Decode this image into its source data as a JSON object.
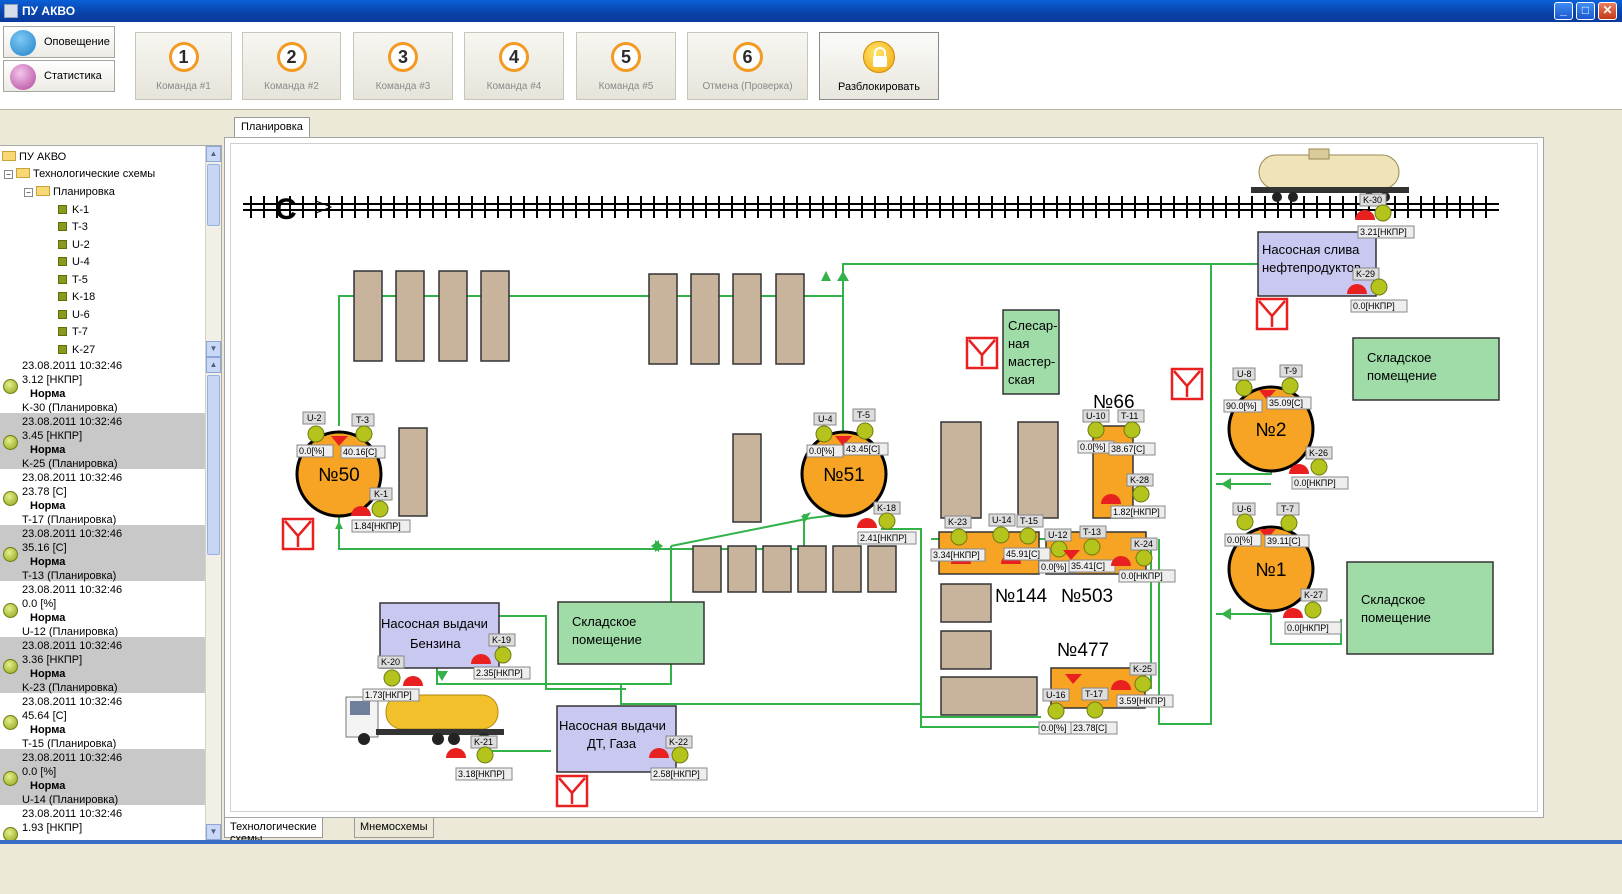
{
  "window": {
    "title": "ПУ АКВО",
    "minimize": "_",
    "maximize": "□",
    "close": "✕"
  },
  "left_tabs": [
    {
      "label": "Оповещение",
      "icon": "megaphone-icon"
    },
    {
      "label": "Статистика",
      "icon": "notepad-icon"
    }
  ],
  "commands": [
    {
      "num": "1",
      "label": "Команда #1"
    },
    {
      "num": "2",
      "label": "Команда #2"
    },
    {
      "num": "3",
      "label": "Команда #3"
    },
    {
      "num": "4",
      "label": "Команда #4"
    },
    {
      "num": "5",
      "label": "Команда #5"
    },
    {
      "num": "6",
      "label": "Отмена (Проверка)"
    }
  ],
  "unlock": {
    "label": "Разблокировать",
    "icon": "lock-icon"
  },
  "tree": {
    "root": "ПУ АКВО",
    "folder": "Технологические схемы",
    "subfolder": "Планировка",
    "items": [
      "K-1",
      "T-3",
      "U-2",
      "U-4",
      "T-5",
      "K-18",
      "U-6",
      "T-7",
      "K-27"
    ]
  },
  "events": [
    {
      "time": "23.08.2011 10:32:46",
      "value": "3.12 [НКПР]",
      "status": "Норма",
      "source": "K-30 (Планировка)"
    },
    {
      "time": "23.08.2011 10:32:46",
      "value": "3.45 [НКПР]",
      "status": "Норма",
      "source": "K-25 (Планировка)"
    },
    {
      "time": "23.08.2011 10:32:46",
      "value": "23.78 [C]",
      "status": "Норма",
      "source": "T-17 (Планировка)"
    },
    {
      "time": "23.08.2011 10:32:46",
      "value": "35.16 [C]",
      "status": "Норма",
      "source": "T-13 (Планировка)"
    },
    {
      "time": "23.08.2011 10:32:46",
      "value": "0.0 [%]",
      "status": "Норма",
      "source": "U-12 (Планировка)"
    },
    {
      "time": "23.08.2011 10:32:46",
      "value": "3.36 [НКПР]",
      "status": "Норма",
      "source": "K-23 (Планировка)"
    },
    {
      "time": "23.08.2011 10:32:46",
      "value": "45.64 [C]",
      "status": "Норма",
      "source": "T-15 (Планировка)"
    },
    {
      "time": "23.08.2011 10:32:46",
      "value": "0.0 [%]",
      "status": "Норма",
      "source": "U-14 (Планировка)"
    },
    {
      "time": "23.08.2011 10:32:46",
      "value": "1.93 [НКПР]",
      "status": "",
      "source": ""
    }
  ],
  "main_tab": "Планировка",
  "bottom_tabs": [
    "Технологические схемы",
    "Мнемосхемы"
  ],
  "scheme": {
    "rail_letter": "C",
    "tanks": [
      {
        "id": "tank-50",
        "label": "№50"
      },
      {
        "id": "tank-51",
        "label": "№51"
      },
      {
        "id": "tank-2",
        "label": "№2"
      },
      {
        "id": "tank-1",
        "label": "№1"
      }
    ],
    "blocks": {
      "n66": "№66",
      "n144": "№144",
      "n503": "№503",
      "n477": "№477"
    },
    "buildings": {
      "pump_drain": [
        "Насосная слива",
        "нефтепродуктов"
      ],
      "storage_top_right": [
        "Складское",
        "помещение"
      ],
      "storage_mid_right": [
        "Складское",
        "помещение"
      ],
      "storage_center": [
        "Складское",
        "помещение"
      ],
      "workshop": [
        "Слесар-",
        "ная",
        "мастер-",
        "ская"
      ],
      "pump_gasoline": [
        "Насосная выдачи",
        "Бензина"
      ],
      "pump_diesel": [
        "Насосная выдачи",
        "ДТ, Газа"
      ]
    },
    "sensor_tags": {
      "U-2": "U-2",
      "T-3": "T-3",
      "K-1": "K-1",
      "U-4": "U-4",
      "T-5": "T-5",
      "K-18": "K-18",
      "U-8": "U-8",
      "T-9": "T-9",
      "K-26": "K-26",
      "U-6": "U-6",
      "T-7": "T-7",
      "K-27": "K-27",
      "K-29": "K-29",
      "K-30": "K-30",
      "U-10": "U-10",
      "T-11": "T-11",
      "K-28": "K-28",
      "K-23": "K-23",
      "U-14": "U-14",
      "T-15": "T-15",
      "U-12": "U-12",
      "T-13": "T-13",
      "K-24": "K-24",
      "K-25": "K-25",
      "U-16": "U-16",
      "T-17": "T-17",
      "K-19": "K-19",
      "K-20": "K-20",
      "K-21": "K-21",
      "K-22": "K-22"
    },
    "readings": {
      "u2": "0.0[%]",
      "t3": "40.16[C]",
      "k1": "1.84[НКПР]",
      "u4": "0.0[%]",
      "t5": "43.45[C]",
      "k18": "2.41[НКПР]",
      "u8": "90.0[%]",
      "t9": "35.09[C]",
      "k26": "0.0[НКПР]",
      "u6": "0.0[%]",
      "t7": "39.11[C]",
      "k27": "0.0[НКПР]",
      "k29": "0.0[НКПР]",
      "k30": "3.21[НКПР]",
      "u10": "0.0[%]",
      "t11": "38.67[C]",
      "k28": "1.82[НКПР]",
      "k23": "3.34[НКПР]",
      "t15": "45.91[C]",
      "u12": "0.0[%]",
      "t13": "35.41[C]",
      "k24": "0.0[НКПР]",
      "k25": "3.59[НКПР]",
      "u16": "0.0[%]",
      "t17": "23.78[C]",
      "k19": "2.35[НКПР]",
      "k20": "1.73[НКПР]",
      "k21": "3.18[НКПР]",
      "k22": "2.58[НКПР]"
    },
    "colors": {
      "pipe": "#33b24a",
      "brown": "#c8b39d",
      "tank": "#f7a424",
      "pump_house": "#c9c8f0",
      "storage": "#9fdca8",
      "alarm": "#e82020",
      "sensor": "#b4c41c"
    }
  }
}
